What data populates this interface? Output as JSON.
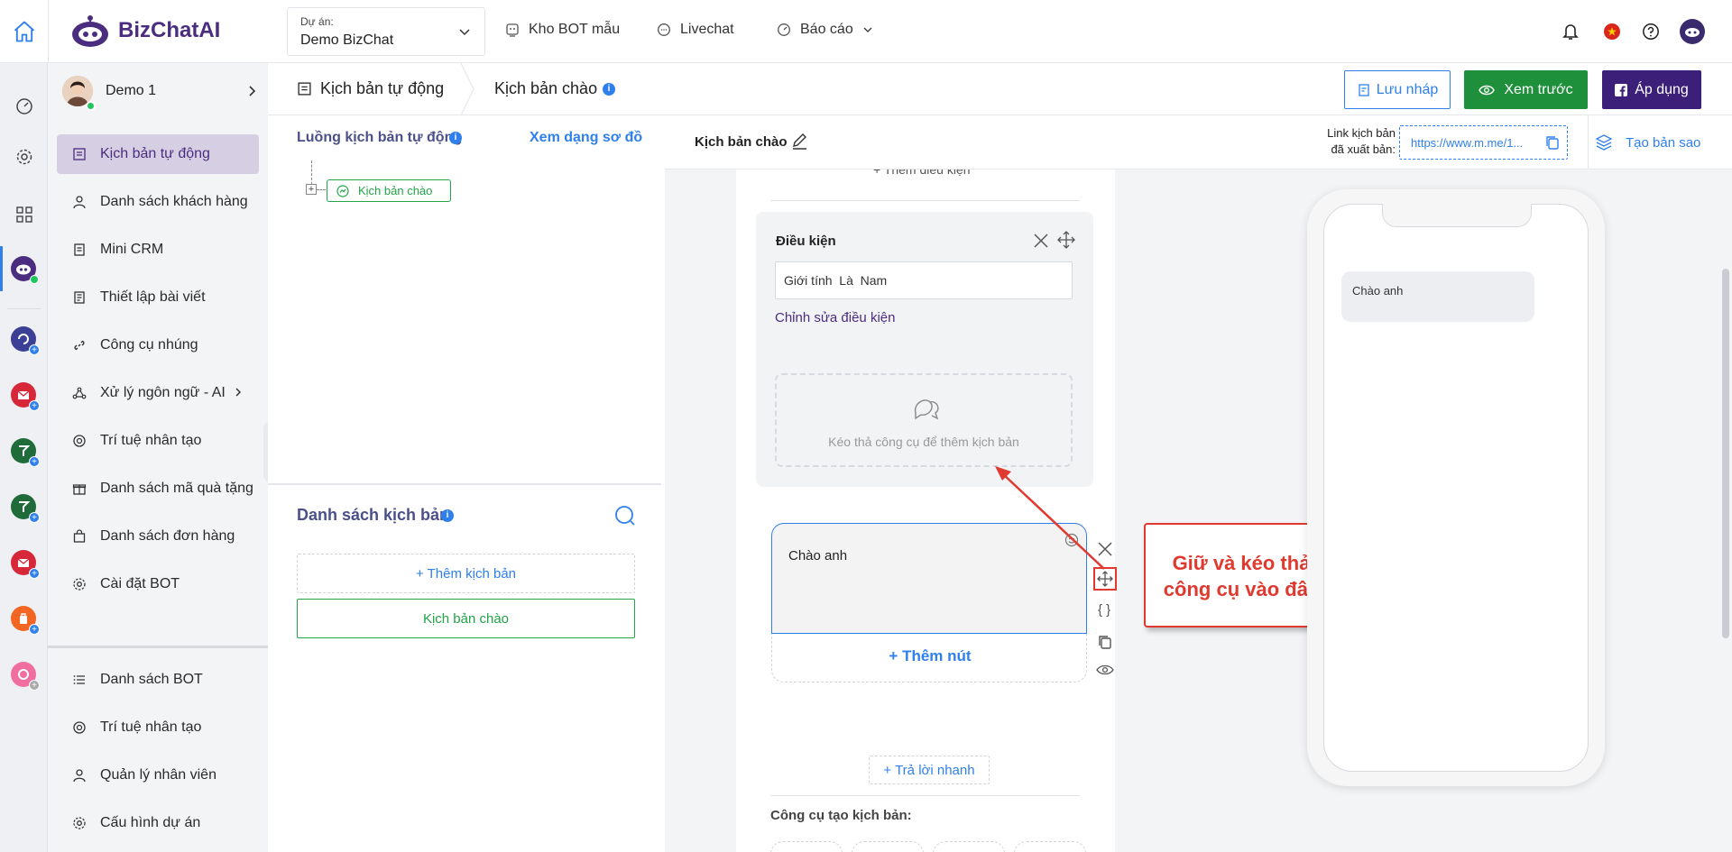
{
  "brand": {
    "name": "BizChatAI"
  },
  "project": {
    "label": "Dự án:",
    "value": "Demo BizChat"
  },
  "topnav": [
    {
      "label": "Kho BOT mẫu"
    },
    {
      "label": "Livechat"
    },
    {
      "label": "Báo cáo"
    }
  ],
  "user": {
    "name": "Demo 1"
  },
  "sidebar": {
    "items": [
      {
        "label": "Kịch bản tự động"
      },
      {
        "label": "Danh sách khách hàng"
      },
      {
        "label": "Mini CRM"
      },
      {
        "label": "Thiết lập bài viết"
      },
      {
        "label": "Công cụ nhúng"
      },
      {
        "label": "Xử lý ngôn ngữ - AI"
      },
      {
        "label": "Trí tuệ nhân tạo"
      },
      {
        "label": "Danh sách mã quà tặng"
      },
      {
        "label": "Danh sách đơn hàng"
      },
      {
        "label": "Cài đặt BOT"
      }
    ],
    "bottom_items": [
      {
        "label": "Danh sách BOT"
      },
      {
        "label": "Trí tuệ nhân tạo"
      },
      {
        "label": "Quản lý nhân viên"
      },
      {
        "label": "Cấu hình dự án"
      }
    ]
  },
  "breadcrumb": {
    "root": "Kịch bản tự động",
    "current": "Kịch bản chào"
  },
  "actions": {
    "save_draft": "Lưu nháp",
    "preview": "Xem trước",
    "apply": "Áp dụng"
  },
  "flow": {
    "title": "Luồng kịch bản tự động",
    "diagram_link": "Xem dạng sơ đồ",
    "node_label": "Kịch bản chào"
  },
  "scripts": {
    "title": "Danh sách kịch bản",
    "add_label": "+ Thêm kịch bản",
    "items": [
      "Kịch bản chào"
    ]
  },
  "editor": {
    "script_name": "Kịch bản chào",
    "link_label_1": "Link kịch bản",
    "link_label_2": "đã xuất bản:",
    "link_value": "https://www.m.me/1...",
    "copy_label": "Tạo bản sao",
    "add_condition_cut": "+ Thêm điều kiện",
    "condition_title": "Điều kiện",
    "condition_value": "Giới tính  Là  Nam",
    "edit_condition": "Chỉnh sửa điều kiện",
    "drop_hint": "Kéo thả công cụ để thêm kịch bản",
    "message_text": "Chào anh",
    "add_button": "+ Thêm nút",
    "quick_reply": "+ Trả lời nhanh",
    "tools_title": "Công cụ tạo kịch bản:"
  },
  "callout": {
    "line1": "Giữ và kéo thả",
    "line2": "công cụ vào đây"
  },
  "preview": {
    "bubble_text": "Chào anh"
  },
  "colors": {
    "brand": "#4b2d7f",
    "green": "#1e8f3a",
    "blue": "#2f80ed",
    "red": "#e0392f",
    "active_bg": "#d6cfe3"
  }
}
